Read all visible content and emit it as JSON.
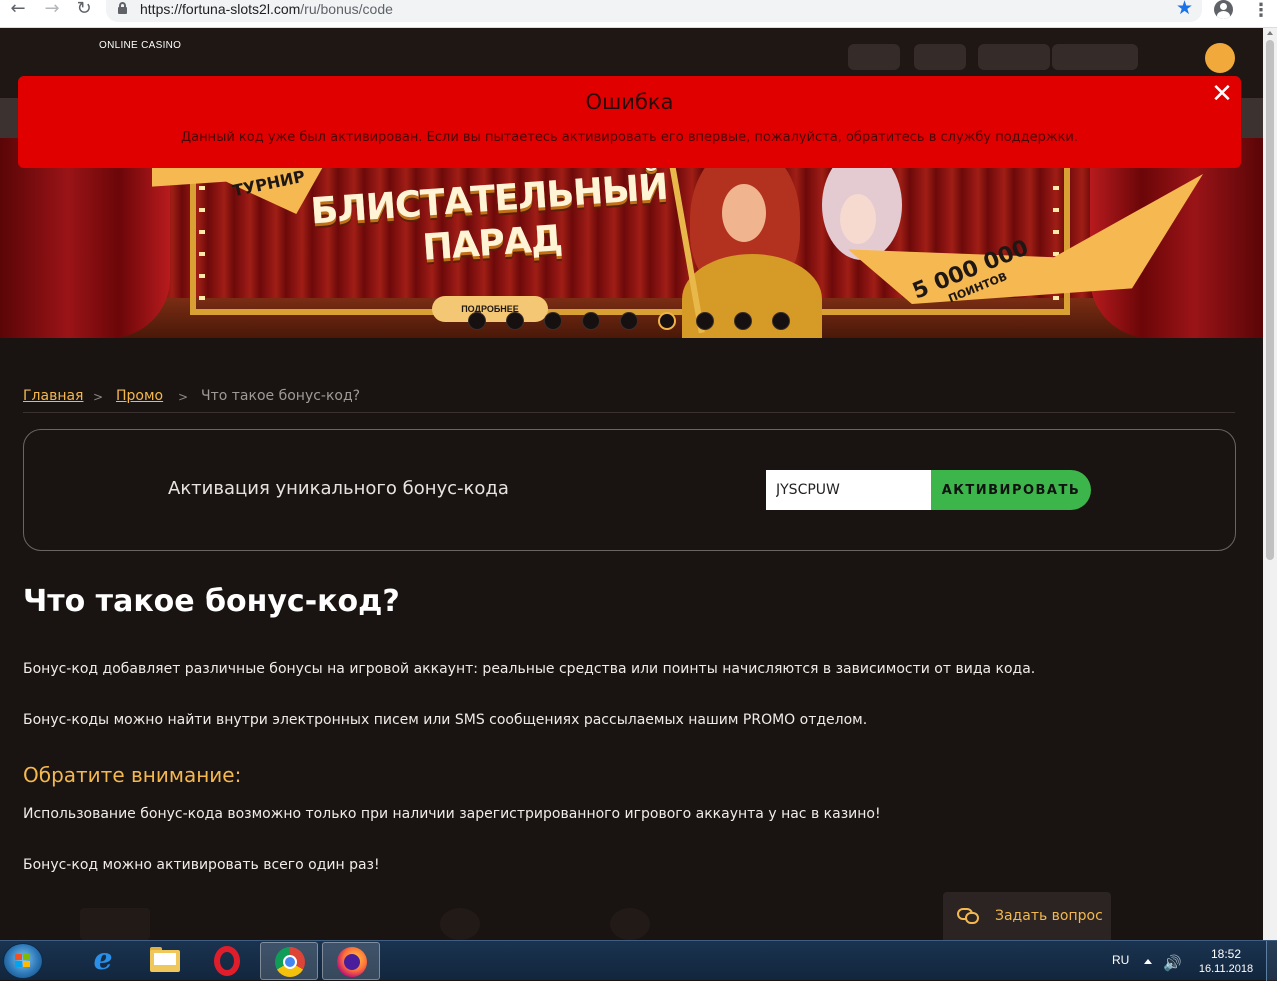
{
  "browser": {
    "url_host": "https://fortuna-slots2l.com",
    "url_path": "/ru/bonus/code"
  },
  "site": {
    "logo_text": "ONLINE CASINO"
  },
  "banner": {
    "ribbon": "ТУРНИР",
    "title_line1": "БЛИСТАТЕЛЬНЫЙ",
    "title_line2": "ПАРАД",
    "more": "ПОДРОБНЕЕ",
    "points_value": "5 000 000",
    "points_label": "ПОИНТОВ",
    "slides": 9,
    "active_slide": 6
  },
  "breadcrumb": {
    "home": "Главная",
    "sep": ">",
    "promo": "Промо",
    "current": "Что такое бонус-код?"
  },
  "activation": {
    "label": "Активация уникального бонус-кода",
    "code_value": "JYSCPUW",
    "button": "АКТИВИРОВАТЬ"
  },
  "article": {
    "title": "Что такое бонус-код?",
    "p1": "Бонус-код добавляет различные бонусы на игровой аккаунт: реальные средства или поинты начисляются в зависимости от вида кода.",
    "p2": "Бонус-коды можно найти внутри электронных писем или SMS сообщениях рассылаемых нашим PROMO отделом.",
    "notice_title": "Обратите внимание:",
    "p3": "Использование бонус-кода возможно только при наличии зарегистрированного игрового аккаунта у нас в казино!",
    "p4": "Бонус-код можно активировать всего один раз!"
  },
  "support": {
    "label": "Задать вопрос"
  },
  "error": {
    "title": "Ошибка",
    "message": "Данный код уже был активирован. Если вы пытаетесь активировать его впервые, пожалуйста, обратитесь в службу поддержки."
  },
  "taskbar": {
    "lang": "RU",
    "time": "18:52",
    "date": "16.11.2018",
    "apps": [
      "internet-explorer",
      "file-explorer",
      "opera",
      "chrome",
      "firefox"
    ],
    "active_app": "chrome"
  },
  "colors": {
    "accent": "#f4b84e",
    "error_bg": "#e00000",
    "activate_btn": "#3cb54a",
    "page_bg": "#191311"
  }
}
